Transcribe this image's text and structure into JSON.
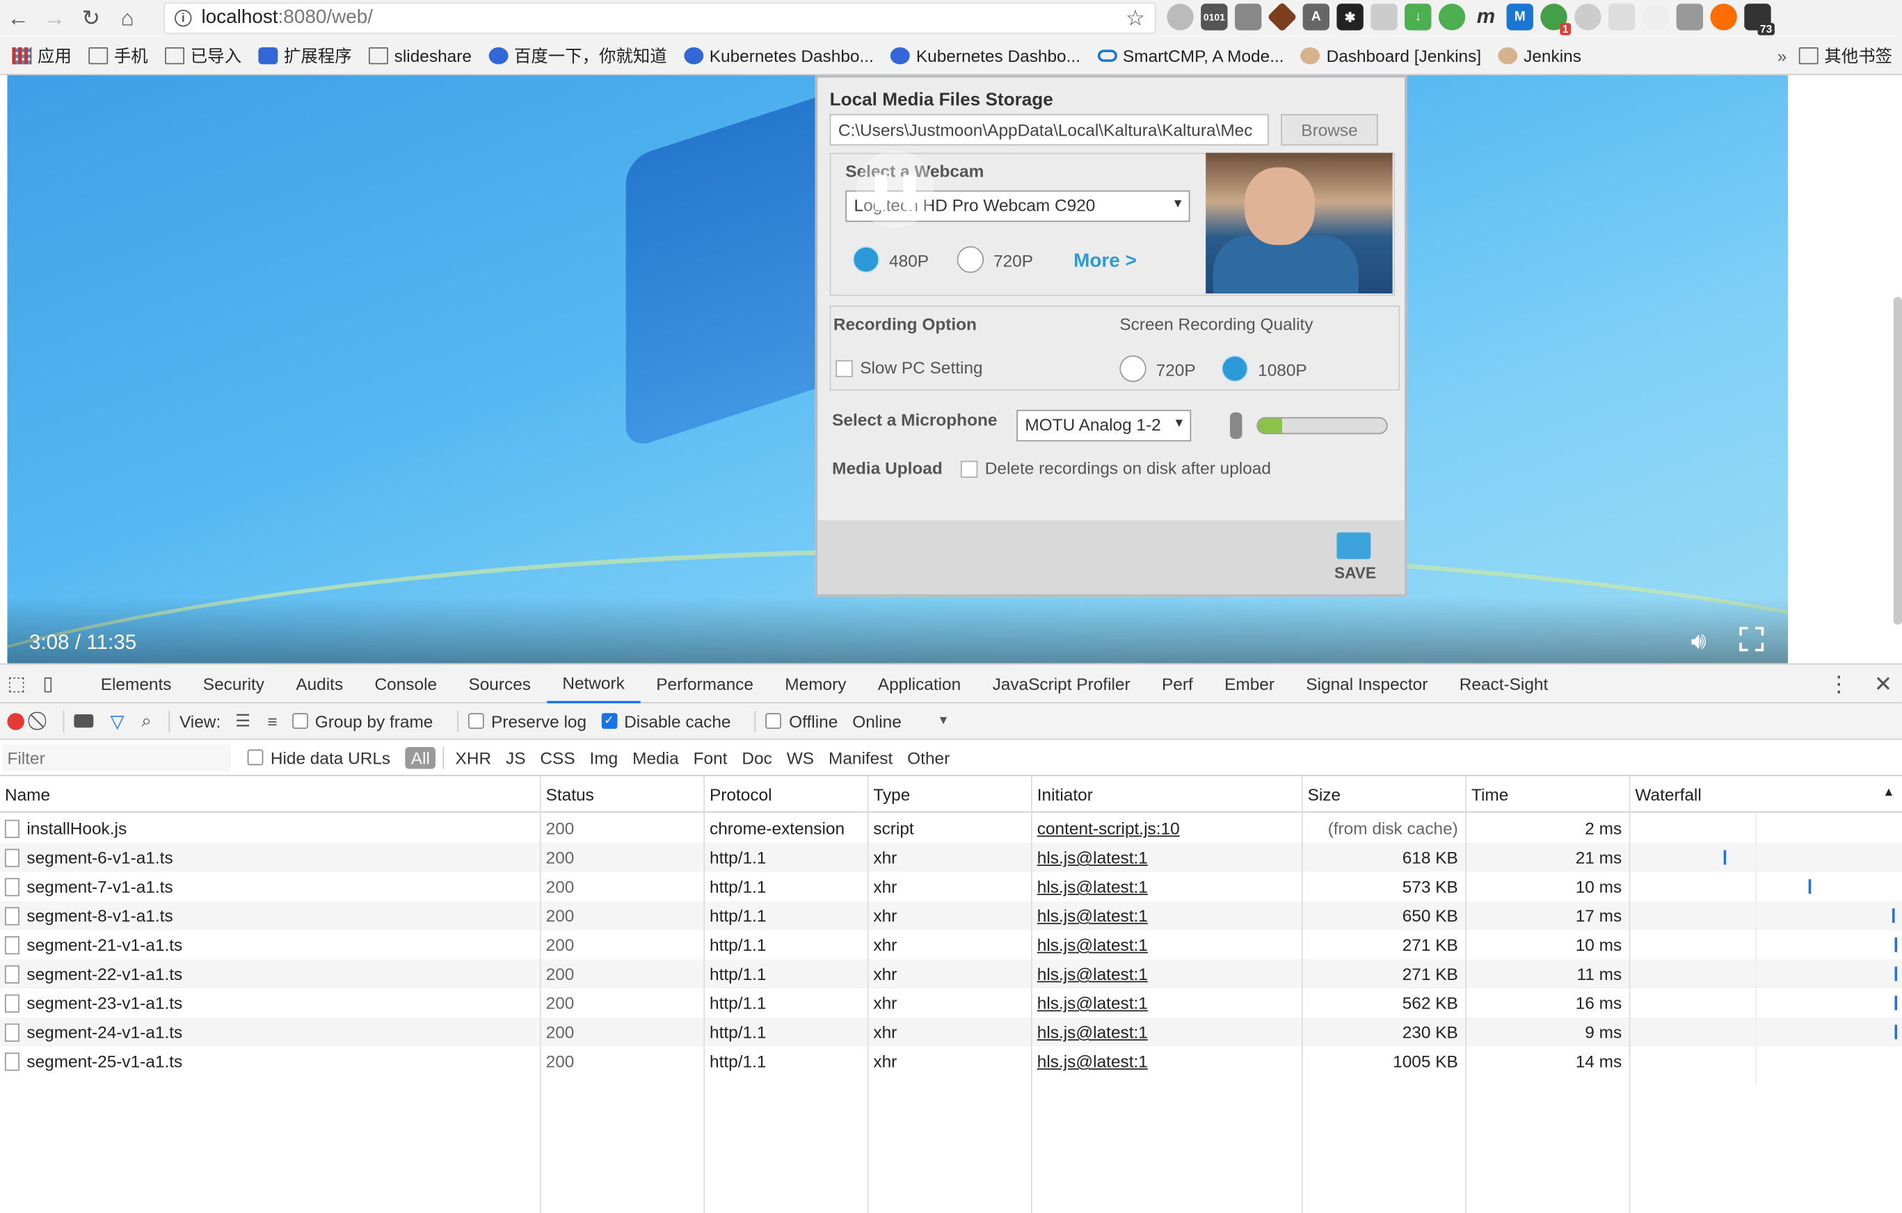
{
  "browser": {
    "url_host": "localhost",
    "url_path": ":8080/web/",
    "bookmarks": [
      "应用",
      "手机",
      "已导入",
      "扩展程序",
      "slideshare",
      "百度一下，你就知道",
      "Kubernetes Dashbo...",
      "Kubernetes Dashbo...",
      "SmartCMP, A Mode...",
      "Dashboard [Jenkins]",
      "Jenkins"
    ],
    "bookmarks_more": "»",
    "other_bookmarks": "其他书签",
    "ext_badges": {
      "ext_1": "1",
      "ext_73": "73"
    },
    "ext_labels": {
      "binary": "0101",
      "m_italic": "m",
      "m_box": "M"
    }
  },
  "video": {
    "time": "3:08 / 11:35",
    "dialog": {
      "storage_title": "Local Media Files Storage",
      "storage_path": "C:\\Users\\Justmoon\\AppData\\Local\\Kaltura\\Kaltura\\Mec",
      "browse": "Browse",
      "webcam_title": "Select a Webcam",
      "webcam_value": "Logitech HD Pro Webcam C920",
      "res_480": "480P",
      "res_720": "720P",
      "more": "More >",
      "rec_option": "Recording Option",
      "slow_pc": "Slow PC Setting",
      "screen_quality": "Screen Recording Quality",
      "q_720": "720P",
      "q_1080": "1080P",
      "mic_title": "Select a Microphone",
      "mic_value": "MOTU Analog 1-2",
      "media_upload": "Media Upload",
      "delete_after": "Delete recordings on disk after upload",
      "save": "SAVE"
    }
  },
  "devtools": {
    "tabs": [
      "Elements",
      "Security",
      "Audits",
      "Console",
      "Sources",
      "Network",
      "Performance",
      "Memory",
      "Application",
      "JavaScript Profiler",
      "Perf",
      "Ember",
      "Signal Inspector",
      "React-Sight"
    ],
    "active_tab": "Network",
    "netbar": {
      "view": "View:",
      "group_by_frame": "Group by frame",
      "preserve_log": "Preserve log",
      "disable_cache": "Disable cache",
      "offline": "Offline",
      "throttle": "Online"
    },
    "filter_placeholder": "Filter",
    "hide_data_urls": "Hide data URLs",
    "types": [
      "All",
      "XHR",
      "JS",
      "CSS",
      "Img",
      "Media",
      "Font",
      "Doc",
      "WS",
      "Manifest",
      "Other"
    ],
    "columns": [
      "Name",
      "Status",
      "Protocol",
      "Type",
      "Initiator",
      "Size",
      "Time",
      "Waterfall"
    ],
    "rows": [
      {
        "name": "installHook.js",
        "status": "200",
        "protocol": "chrome-extension",
        "type": "script",
        "initiator": "content-script.js:10",
        "size": "(from disk cache)",
        "time": "2 ms",
        "wf": null
      },
      {
        "name": "segment-6-v1-a1.ts",
        "status": "200",
        "protocol": "http/1.1",
        "type": "xhr",
        "initiator": "hls.js@latest:1",
        "size": "618 KB",
        "time": "21 ms",
        "wf": 0.35
      },
      {
        "name": "segment-7-v1-a1.ts",
        "status": "200",
        "protocol": "http/1.1",
        "type": "xhr",
        "initiator": "hls.js@latest:1",
        "size": "573 KB",
        "time": "10 ms",
        "wf": 0.67
      },
      {
        "name": "segment-8-v1-a1.ts",
        "status": "200",
        "protocol": "http/1.1",
        "type": "xhr",
        "initiator": "hls.js@latest:1",
        "size": "650 KB",
        "time": "17 ms",
        "wf": 0.98
      },
      {
        "name": "segment-21-v1-a1.ts",
        "status": "200",
        "protocol": "http/1.1",
        "type": "xhr",
        "initiator": "hls.js@latest:1",
        "size": "271 KB",
        "time": "10 ms",
        "wf": 0.99
      },
      {
        "name": "segment-22-v1-a1.ts",
        "status": "200",
        "protocol": "http/1.1",
        "type": "xhr",
        "initiator": "hls.js@latest:1",
        "size": "271 KB",
        "time": "11 ms",
        "wf": 0.99
      },
      {
        "name": "segment-23-v1-a1.ts",
        "status": "200",
        "protocol": "http/1.1",
        "type": "xhr",
        "initiator": "hls.js@latest:1",
        "size": "562 KB",
        "time": "16 ms",
        "wf": 0.99
      },
      {
        "name": "segment-24-v1-a1.ts",
        "status": "200",
        "protocol": "http/1.1",
        "type": "xhr",
        "initiator": "hls.js@latest:1",
        "size": "230 KB",
        "time": "9 ms",
        "wf": 0.99
      },
      {
        "name": "segment-25-v1-a1.ts",
        "status": "200",
        "protocol": "http/1.1",
        "type": "xhr",
        "initiator": "hls.js@latest:1",
        "size": "1005 KB",
        "time": "14 ms",
        "wf": null
      }
    ]
  }
}
